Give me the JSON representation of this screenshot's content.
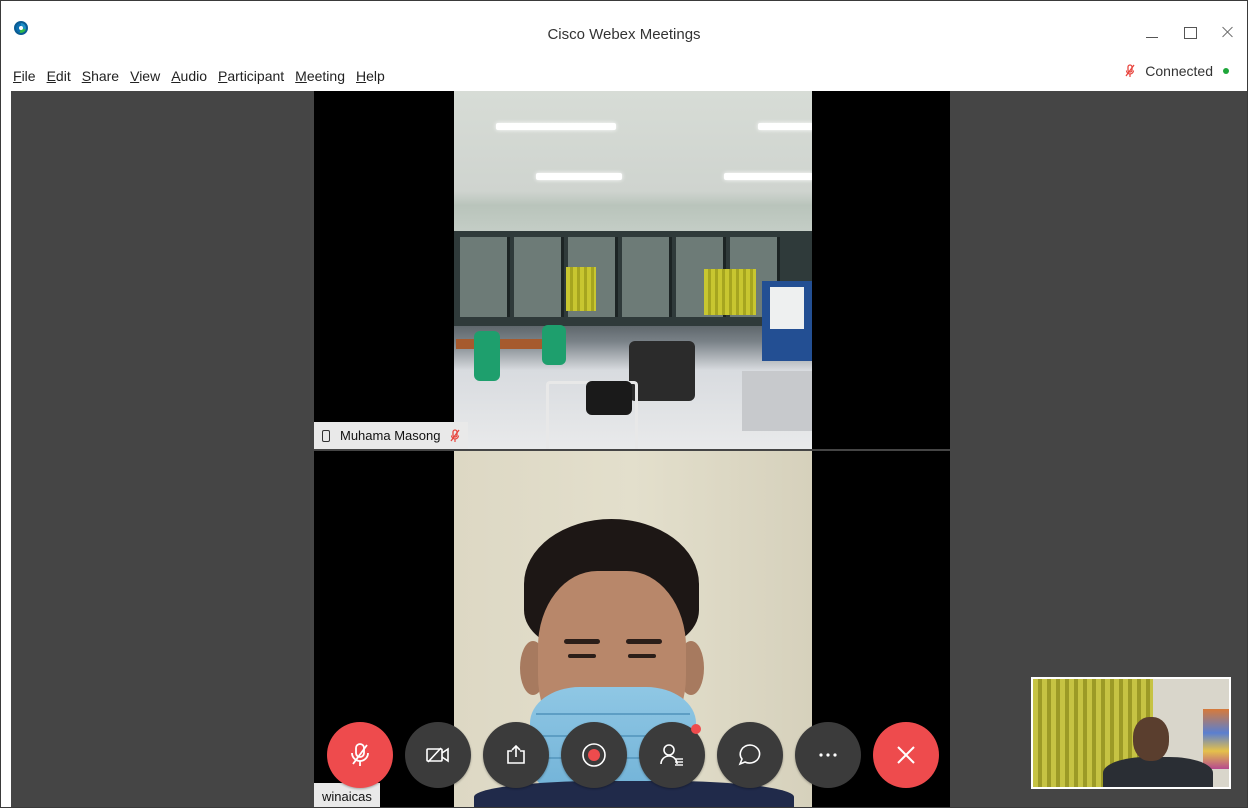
{
  "window": {
    "title": "Cisco Webex Meetings"
  },
  "menu": {
    "items": [
      {
        "label": "File"
      },
      {
        "label": "Edit"
      },
      {
        "label": "Share"
      },
      {
        "label": "View"
      },
      {
        "label": "Audio"
      },
      {
        "label": "Participant"
      },
      {
        "label": "Meeting"
      },
      {
        "label": "Help"
      }
    ]
  },
  "status": {
    "connection": "Connected",
    "connection_color": "#1ea63a",
    "mute_color": "#e8463f"
  },
  "videos": {
    "top": {
      "name": "Muhama Masong",
      "device_icon": "phone-icon",
      "audio_icon": "mic-muted-icon"
    },
    "bottom": {
      "name": "winaicas"
    }
  },
  "controls": [
    {
      "name": "mute-button",
      "icon": "mic-muted-icon",
      "color": "#ee4b4d"
    },
    {
      "name": "stop-video-button",
      "icon": "video-off-icon"
    },
    {
      "name": "share-button",
      "icon": "share-icon"
    },
    {
      "name": "record-button",
      "icon": "record-icon"
    },
    {
      "name": "participants-button",
      "icon": "participants-icon",
      "has_notification": true
    },
    {
      "name": "chat-button",
      "icon": "chat-icon"
    },
    {
      "name": "more-options-button",
      "icon": "more-icon"
    },
    {
      "name": "leave-meeting-button",
      "icon": "close-icon",
      "color": "#ee4b4d"
    }
  ]
}
